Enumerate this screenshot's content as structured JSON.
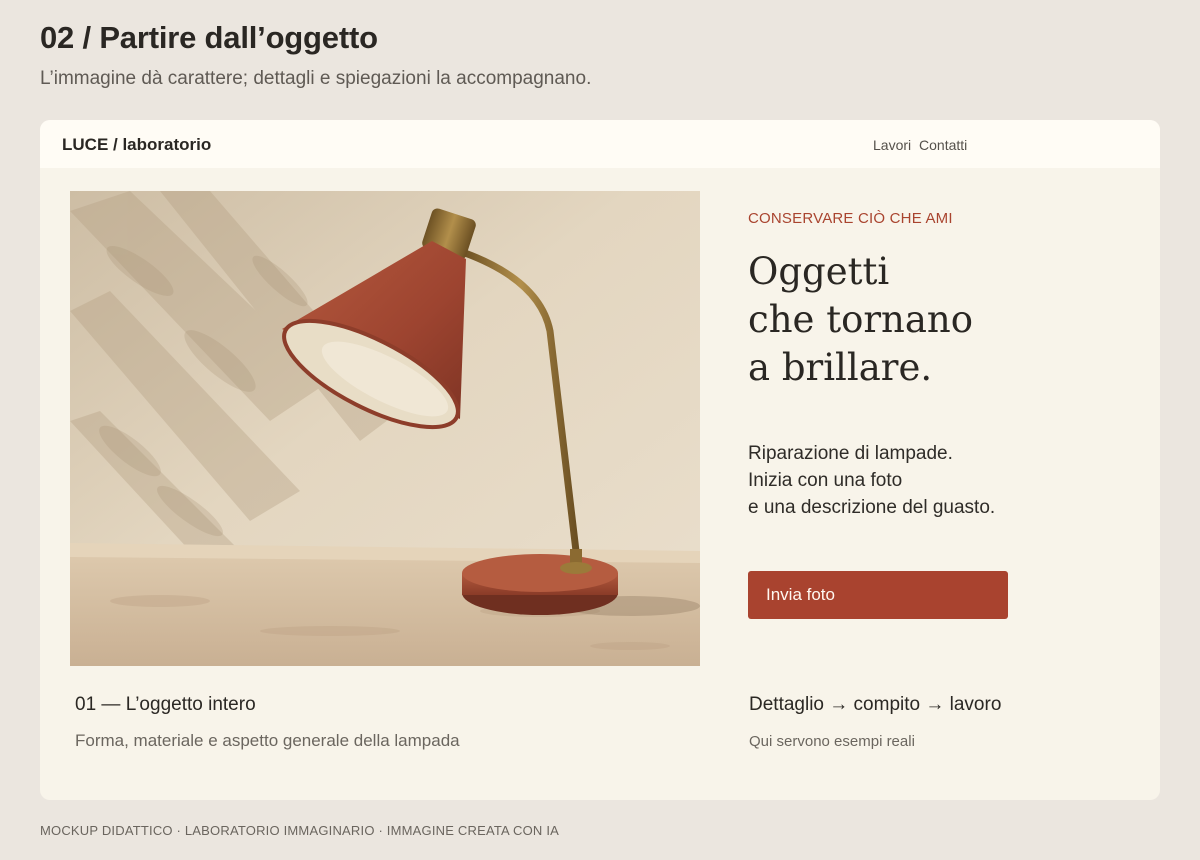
{
  "header": {
    "title": "02 / Partire dall’oggetto",
    "subtitle": "L’immagine dà carattere; dettagli e spiegazioni la accompagnano."
  },
  "site": {
    "brand": "LUCE / laboratorio",
    "nav": [
      "Lavori",
      "Contatti"
    ]
  },
  "hero": {
    "eyebrow": "CONSERVARE CIÒ CHE AMI",
    "headline": [
      "Oggetti",
      "che tornano",
      "a brillare."
    ],
    "description": [
      "Riparazione di lampade.",
      "Inizia con una foto",
      "e una descrizione del guasto."
    ],
    "cta_label": "Invia foto"
  },
  "captions": [
    {
      "title": "01 — L’oggetto intero",
      "subtitle": "Forma, materiale e aspetto generale della lampada"
    },
    {
      "title": "Dettaglio → compito → lavoro",
      "subtitle": "Qui servono esempi reali"
    }
  ],
  "footer": "MOCKUP DIDATTICO · LABORATORIO IMMAGINARIO · IMMAGINE CREATA CON IA",
  "colors": {
    "page_background": "#ebe6df",
    "card_background": "#f8f4ea",
    "accent": "#a9432f",
    "text": "#2a2723"
  }
}
